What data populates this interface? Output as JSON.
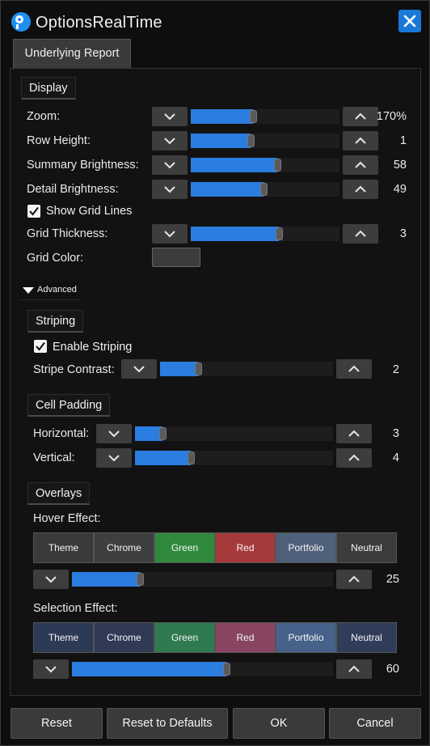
{
  "window": {
    "title": "OptionsRealTime",
    "close_icon": "close-icon"
  },
  "tab": {
    "label": "Underlying Report"
  },
  "display": {
    "group_label": "Display",
    "zoom": {
      "label": "Zoom:",
      "value": "170%",
      "level": 0.42
    },
    "row_height": {
      "label": "Row Height:",
      "value": "1",
      "level": 0.4
    },
    "summary_brightness": {
      "label": "Summary Brightness:",
      "value": "58",
      "level": 0.58
    },
    "detail_brightness": {
      "label": "Detail Brightness:",
      "value": "49",
      "level": 0.49
    },
    "show_grid_lines": {
      "label": "Show Grid Lines",
      "checked": true
    },
    "grid_thickness": {
      "label": "Grid Thickness:",
      "value": "3",
      "level": 0.59
    },
    "grid_color": {
      "label": "Grid Color:",
      "color": "#3c3c3c"
    }
  },
  "advanced": {
    "label": "Advanced"
  },
  "striping": {
    "group_label": "Striping",
    "enable": {
      "label": "Enable Striping",
      "checked": true
    },
    "stripe_contrast": {
      "label": "Stripe Contrast:",
      "value": "2",
      "level": 0.22
    }
  },
  "cell_padding": {
    "group_label": "Cell Padding",
    "horizontal": {
      "label": "Horizontal:",
      "value": "3",
      "level": 0.14
    },
    "vertical": {
      "label": "Vertical:",
      "value": "4",
      "level": 0.28
    }
  },
  "overlays": {
    "group_label": "Overlays",
    "hover": {
      "label": "Hover Effect:",
      "value": "25",
      "level": 0.26,
      "swatches": [
        {
          "label": "Theme",
          "color": "#3a3a3a"
        },
        {
          "label": "Chrome",
          "color": "#3f3f3f"
        },
        {
          "label": "Green",
          "color": "#2f8a3e"
        },
        {
          "label": "Red",
          "color": "#a63a3a"
        },
        {
          "label": "Portfolio",
          "color": "#4f607a"
        },
        {
          "label": "Neutral",
          "color": "#3c3c3c"
        }
      ]
    },
    "selection": {
      "label": "Selection Effect:",
      "value": "60",
      "level": 0.59,
      "swatches": [
        {
          "label": "Theme",
          "color": "#2d3a55"
        },
        {
          "label": "Chrome",
          "color": "#303a55"
        },
        {
          "label": "Green",
          "color": "#2f7a4f"
        },
        {
          "label": "Red",
          "color": "#884562"
        },
        {
          "label": "Portfolio",
          "color": "#46628a"
        },
        {
          "label": "Neutral",
          "color": "#2f3d5a"
        }
      ]
    }
  },
  "footer": {
    "reset": "Reset",
    "reset_defaults": "Reset to Defaults",
    "ok": "OK",
    "cancel": "Cancel"
  },
  "colors": {
    "accent": "#2b7de0",
    "close_bg": "#1979d6"
  }
}
